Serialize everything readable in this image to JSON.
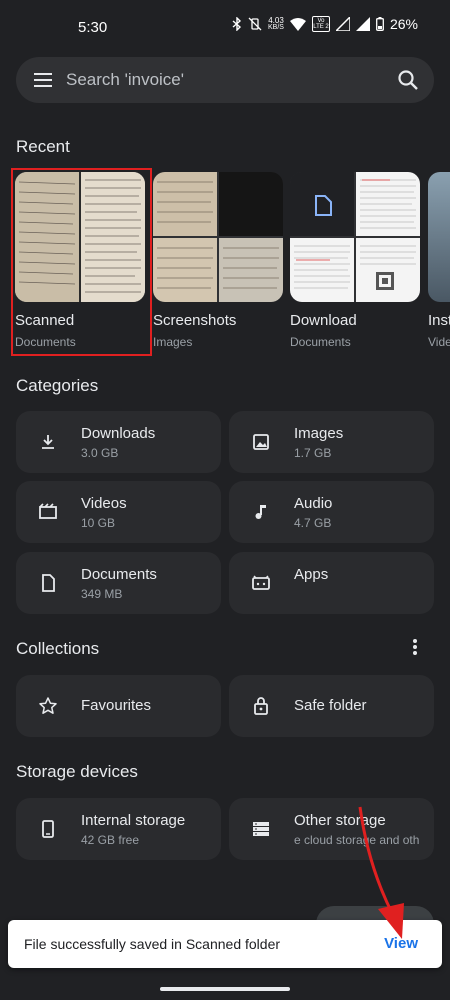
{
  "status_bar": {
    "time": "5:30",
    "speed_value": "4.03",
    "speed_unit": "KB/S",
    "volte": "Vo LTE 2",
    "battery": "26%"
  },
  "search": {
    "placeholder": "Search 'invoice'"
  },
  "recent": {
    "title": "Recent",
    "items": [
      {
        "name": "Scanned",
        "type": "Documents"
      },
      {
        "name": "Screenshots",
        "type": "Images"
      },
      {
        "name": "Download",
        "type": "Documents"
      },
      {
        "name": "Inst",
        "type": "Vide"
      }
    ]
  },
  "categories": {
    "title": "Categories",
    "items": [
      {
        "name": "Downloads",
        "size": "3.0 GB",
        "icon": "download-icon"
      },
      {
        "name": "Images",
        "size": "1.7 GB",
        "icon": "image-icon"
      },
      {
        "name": "Videos",
        "size": "10 GB",
        "icon": "video-icon"
      },
      {
        "name": "Audio",
        "size": "4.7 GB",
        "icon": "music-note-icon"
      },
      {
        "name": "Documents",
        "size": "349 MB",
        "icon": "document-icon"
      },
      {
        "name": "Apps",
        "size": "",
        "icon": "android-icon"
      }
    ]
  },
  "collections": {
    "title": "Collections",
    "items": [
      {
        "name": "Favourites",
        "icon": "star-icon"
      },
      {
        "name": "Safe folder",
        "icon": "lock-icon"
      }
    ]
  },
  "storage": {
    "title": "Storage devices",
    "items": [
      {
        "name": "Internal storage",
        "detail": "42 GB free",
        "icon": "phone-icon"
      },
      {
        "name": "Other storage",
        "detail": "e cloud storage and oth",
        "icon": "storage-icon"
      }
    ]
  },
  "snackbar": {
    "message": "File successfully saved in Scanned folder",
    "action": "View"
  },
  "colors": {
    "background": "#202124",
    "tile": "#2a2b2e",
    "highlight": "#e02020",
    "action": "#1a73e8",
    "arrow": "#e02020"
  }
}
